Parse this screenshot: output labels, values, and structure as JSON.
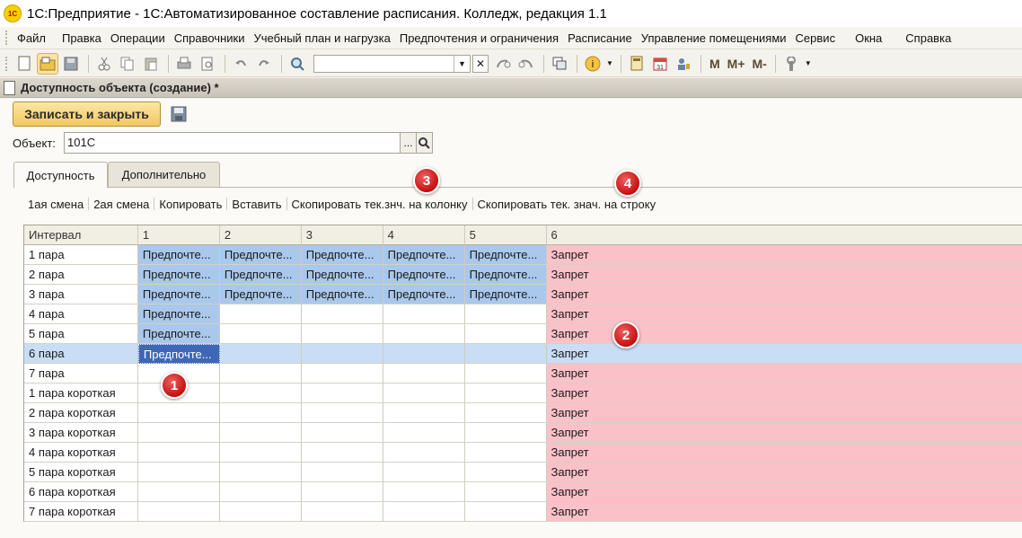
{
  "window": {
    "title": "1С:Предприятие - 1С:Автоматизированное составление расписания. Колледж, редакция 1.1",
    "logo": "1С"
  },
  "menu": [
    "Файл",
    "Правка",
    "Операции",
    "Справочники",
    "Учебный план и нагрузка",
    "Предпочтения и ограничения",
    "Расписание",
    "Управление помещениями",
    "Сервис",
    "Окна",
    "Справка"
  ],
  "toolbar": {
    "text_buttons": [
      "M",
      "M+",
      "M-"
    ],
    "search_value": ""
  },
  "form": {
    "title": "Доступность объекта (создание) *",
    "save_close_label": "Записать и закрыть",
    "object_label": "Объект:",
    "object_value": "101С",
    "object_select_label": "...",
    "tabs": [
      "Доступность",
      "Дополнительно"
    ],
    "commands": [
      "1ая смена",
      "2ая смена",
      "Копировать",
      "Вставить",
      "Скопировать тек.знч. на колонку",
      "Скопировать тек. знач. на строку"
    ]
  },
  "grid": {
    "columns": [
      "Интервал",
      "1",
      "2",
      "3",
      "4",
      "5",
      "6"
    ],
    "rows": [
      {
        "interval": "1 пара",
        "cells": [
          "Предпочте...",
          "Предпочте...",
          "Предпочте...",
          "Предпочте...",
          "Предпочте...",
          "Запрет"
        ]
      },
      {
        "interval": "2 пара",
        "cells": [
          "Предпочте...",
          "Предпочте...",
          "Предпочте...",
          "Предпочте...",
          "Предпочте...",
          "Запрет"
        ]
      },
      {
        "interval": "3 пара",
        "cells": [
          "Предпочте...",
          "Предпочте...",
          "Предпочте...",
          "Предпочте...",
          "Предпочте...",
          "Запрет"
        ]
      },
      {
        "interval": "4 пара",
        "cells": [
          "Предпочте...",
          "",
          "",
          "",
          "",
          "Запрет"
        ]
      },
      {
        "interval": "5 пара",
        "cells": [
          "Предпочте...",
          "",
          "",
          "",
          "",
          "Запрет"
        ]
      },
      {
        "interval": "6 пара",
        "cells": [
          "Предпочте...",
          "",
          "",
          "",
          "",
          "Запрет"
        ],
        "selected": true
      },
      {
        "interval": "7 пара",
        "cells": [
          "",
          "",
          "",
          "",
          "",
          "Запрет"
        ]
      },
      {
        "interval": "1 пара короткая",
        "cells": [
          "",
          "",
          "",
          "",
          "",
          "Запрет"
        ]
      },
      {
        "interval": "2 пара короткая",
        "cells": [
          "",
          "",
          "",
          "",
          "",
          "Запрет"
        ]
      },
      {
        "interval": "3 пара короткая",
        "cells": [
          "",
          "",
          "",
          "",
          "",
          "Запрет"
        ]
      },
      {
        "interval": "4 пара короткая",
        "cells": [
          "",
          "",
          "",
          "",
          "",
          "Запрет"
        ]
      },
      {
        "interval": "5 пара короткая",
        "cells": [
          "",
          "",
          "",
          "",
          "",
          "Запрет"
        ]
      },
      {
        "interval": "6 пара короткая",
        "cells": [
          "",
          "",
          "",
          "",
          "",
          "Запрет"
        ]
      },
      {
        "interval": "7 пара короткая",
        "cells": [
          "",
          "",
          "",
          "",
          "",
          "Запрет"
        ]
      }
    ]
  },
  "callouts": [
    "1",
    "2",
    "3",
    "4"
  ],
  "colors": {
    "preference": "#a9c8ec",
    "deny": "#fbc1c9",
    "selection": "#3f67b7",
    "callout": "#d01818"
  }
}
